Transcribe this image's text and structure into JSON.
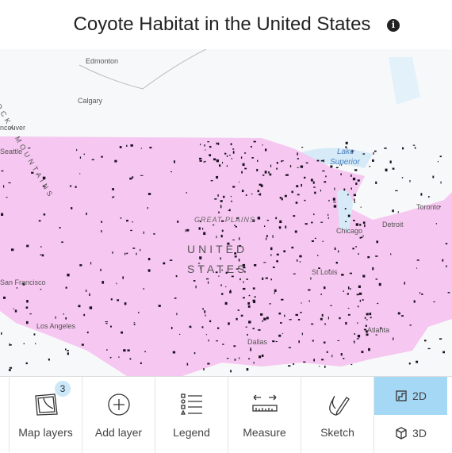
{
  "title": "Coyote Habitat in the United States",
  "info_icon": "info-icon",
  "colors": {
    "habitat": "#f6c7f0",
    "water": "#d6ebf7",
    "active": "#a5d8f5"
  },
  "map": {
    "labels": {
      "edmonton": "Edmonton",
      "calgary": "Calgary",
      "vancouver": "ncouver",
      "seattle": "Seattle",
      "rocky": "ROCKY MOUNTAINS",
      "lake": "Lake",
      "superior": "Superior",
      "toronto": "Toronto",
      "great_plains": "GREAT PLAINS",
      "united": "UNITED",
      "states": "STATES",
      "chicago": "Chicago",
      "detroit": "Detroit",
      "st_louis": "St Louis",
      "san_francisco": "San Francisco",
      "los_angeles": "Los Angeles",
      "dallas": "Dallas",
      "atlanta": "Atlanta"
    }
  },
  "toolbar": {
    "map_layers": "Map layers",
    "map_layers_count": "3",
    "add_layer": "Add layer",
    "legend": "Legend",
    "measure": "Measure",
    "sketch": "Sketch",
    "view_2d": "2D",
    "view_3d": "3D",
    "active_view": "2D"
  }
}
